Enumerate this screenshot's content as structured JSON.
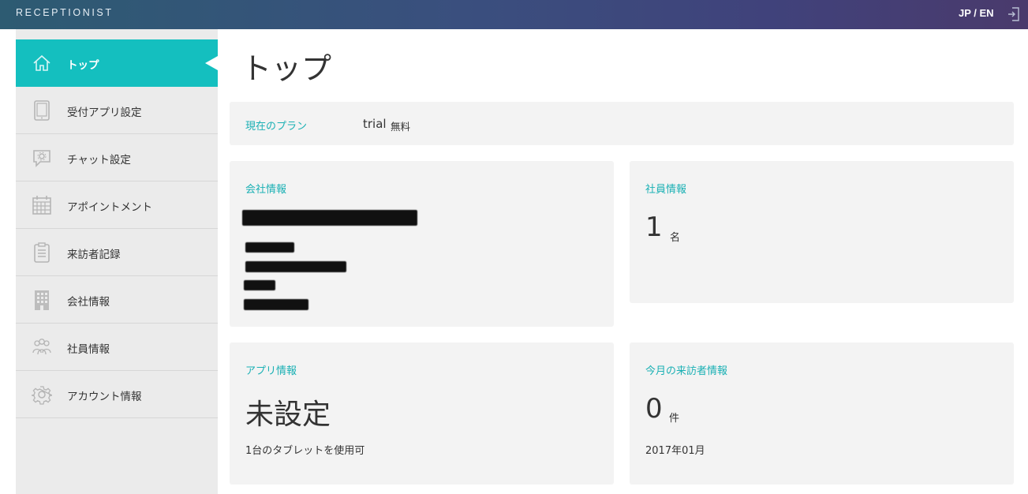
{
  "header": {
    "brand": "RECEPTIONIST",
    "language": "JP / EN",
    "logout_icon": "logout-icon"
  },
  "sidebar": {
    "items": [
      {
        "label": "トップ",
        "icon": "home-icon",
        "active": true
      },
      {
        "label": "受付アプリ設定",
        "icon": "tablet-icon"
      },
      {
        "label": "チャット設定",
        "icon": "chat-settings-icon"
      },
      {
        "label": "アポイントメント",
        "icon": "calendar-icon"
      },
      {
        "label": "来訪者記録",
        "icon": "clipboard-icon"
      },
      {
        "label": "会社情報",
        "icon": "building-icon"
      },
      {
        "label": "社員情報",
        "icon": "people-icon"
      },
      {
        "label": "アカウント情報",
        "icon": "gear-icon"
      }
    ]
  },
  "main": {
    "title": "トップ",
    "plan": {
      "label": "現在のプラン",
      "name": "trial",
      "price": "無料"
    },
    "company": {
      "title": "会社情報"
    },
    "staff": {
      "title": "社員情報",
      "count": "1",
      "unit": "名"
    },
    "app": {
      "title": "アプリ情報",
      "status": "未設定",
      "note": "1台のタブレットを使用可"
    },
    "visitors": {
      "title": "今月の来訪者情報",
      "count": "0",
      "unit": "件",
      "month": "2017年01月"
    }
  },
  "colors": {
    "accent": "#14bfbf",
    "accent_text": "#1ab0b4",
    "sidebar_bg": "#ebebeb",
    "panel_bg": "#f3f3f3"
  }
}
